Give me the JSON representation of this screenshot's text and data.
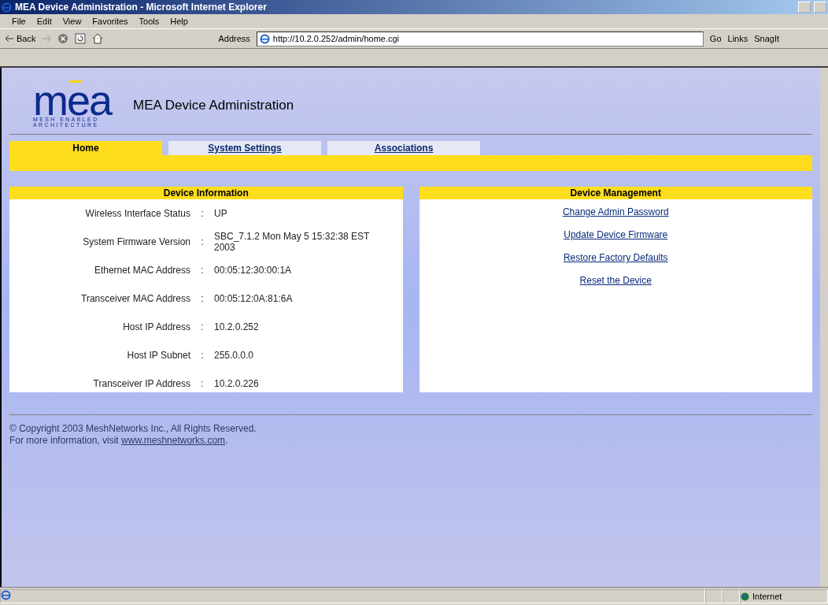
{
  "window": {
    "title": "MEA Device Administration - Microsoft Internet Explorer"
  },
  "menu": [
    "File",
    "Edit",
    "View",
    "Favorites",
    "Tools",
    "Help"
  ],
  "toolbar": {
    "back": "Back",
    "address_label": "Address",
    "address": "http://10.2.0.252/admin/home.cgi",
    "go": "Go",
    "links": "Links",
    "snagit": "SnagIt"
  },
  "logo": {
    "mark": "mea",
    "line_1": "MESH ENABLED",
    "line_2": "ARCHITECTURE"
  },
  "page_title": "MEA Device Administration",
  "tabs": [
    {
      "label": "Home",
      "selected": true
    },
    {
      "label": "System Settings",
      "selected": false
    },
    {
      "label": "Associations",
      "selected": false
    }
  ],
  "device_information": {
    "title": "Device Information",
    "rows": [
      {
        "label": "Wireless Interface Status",
        "separator": ":",
        "value": "UP"
      },
      {
        "label": "System Firmware Version",
        "separator": ":",
        "value": "SBC_7.1.2 Mon May 5 15:32:38 EST 2003"
      },
      {
        "label": "Ethernet MAC Address",
        "separator": ":",
        "value": "00:05:12:30:00:1A"
      },
      {
        "label": "Transceiver MAC Address",
        "separator": ":",
        "value": "00:05:12:0A:81:6A"
      },
      {
        "label": "Host IP Address",
        "separator": ":",
        "value": "10.2.0.252"
      },
      {
        "label": "Host IP Subnet",
        "separator": ":",
        "value": "255.0.0.0"
      },
      {
        "label": "Transceiver IP Address",
        "separator": ":",
        "value": "10.2.0.226"
      }
    ]
  },
  "device_management": {
    "title": "Device Management",
    "links": [
      "Change Admin Password",
      "Update Device Firmware",
      "Restore Factory Defaults",
      "Reset the Device"
    ]
  },
  "footer": {
    "copyright": "© Copyright 2003 MeshNetworks Inc., All Rights Reserved.",
    "more_info": "For more information, visit",
    "link": "www.meshnetworks.com",
    "after": "."
  },
  "status_bar": {
    "zone": "Internet"
  }
}
